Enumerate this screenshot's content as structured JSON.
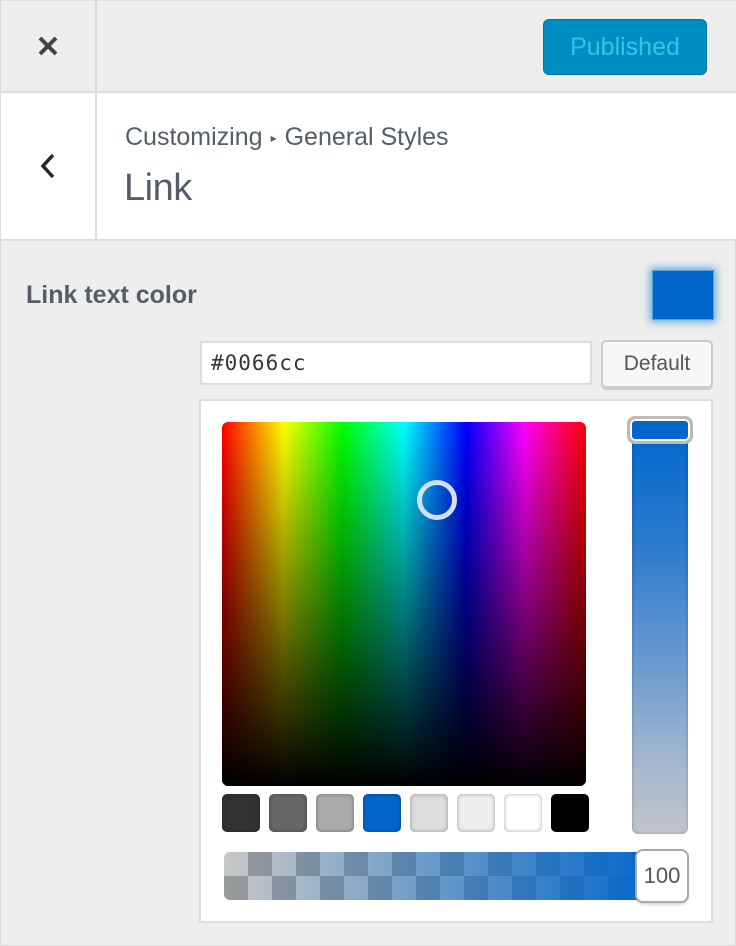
{
  "header": {
    "close_icon": "close-icon",
    "publish_button": "Published"
  },
  "section": {
    "back_icon": "chevron-left-icon",
    "breadcrumb": {
      "root": "Customizing",
      "separator": "▸",
      "parent": "General Styles"
    },
    "title": "Link"
  },
  "control": {
    "label": "Link text color",
    "current_color": "#0066cc",
    "hex_input_value": "#0066cc",
    "default_button": "Default",
    "picker": {
      "palette": [
        {
          "name": "dark-gray",
          "color": "#333333"
        },
        {
          "name": "gray",
          "color": "#666666"
        },
        {
          "name": "light-gray",
          "color": "#aaaaaa"
        },
        {
          "name": "blue",
          "color": "#0066cc"
        },
        {
          "name": "lighter-gray",
          "color": "#dddddd"
        },
        {
          "name": "near-white",
          "color": "#eeeeee"
        },
        {
          "name": "white",
          "color": "#ffffff"
        },
        {
          "name": "black",
          "color": "#000000"
        }
      ],
      "alpha_value": "100"
    }
  }
}
